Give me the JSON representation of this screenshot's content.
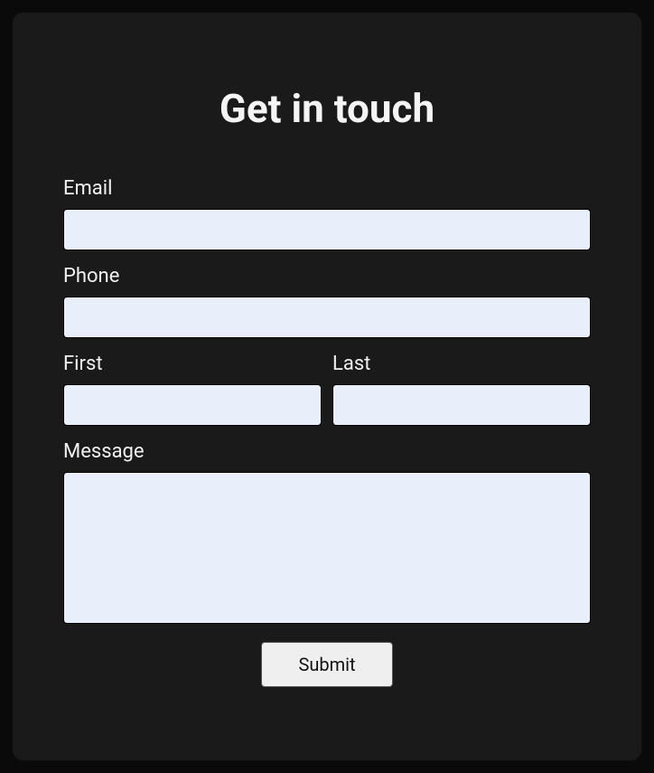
{
  "form": {
    "title": "Get in touch",
    "fields": {
      "email": {
        "label": "Email",
        "value": ""
      },
      "phone": {
        "label": "Phone",
        "value": ""
      },
      "first": {
        "label": "First",
        "value": ""
      },
      "last": {
        "label": "Last",
        "value": ""
      },
      "message": {
        "label": "Message",
        "value": ""
      }
    },
    "submit_label": "Submit"
  }
}
